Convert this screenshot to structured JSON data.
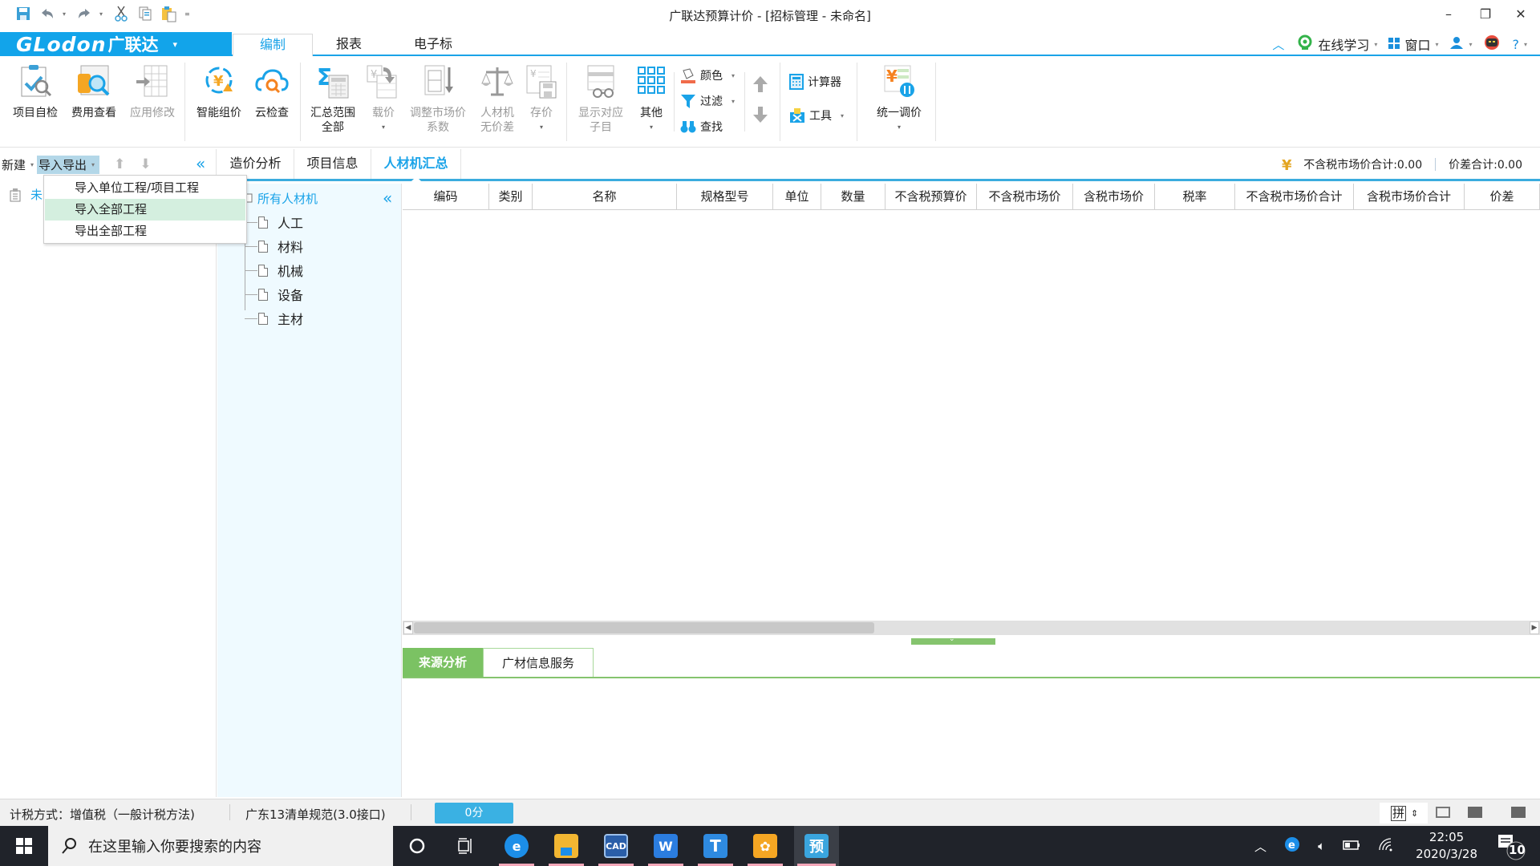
{
  "window": {
    "title": "广联达预算计价 - [招标管理 - 未命名]",
    "minimize_icon": "minimize-icon",
    "restore_icon": "restore-icon",
    "close_icon": "close-icon"
  },
  "quick_access": [
    "save-icon",
    "undo-icon",
    "redo-icon",
    "cut-icon",
    "copy-icon",
    "paste-icon",
    "customize-icon"
  ],
  "menubar": {
    "logo_brand": "GLodon",
    "logo_cn": "广联达",
    "logo_dropdown": "▾",
    "tabs": [
      {
        "label": "编制",
        "active": true
      },
      {
        "label": "报表",
        "active": false
      },
      {
        "label": "电子标",
        "active": false
      }
    ],
    "right": {
      "collapse": "^",
      "online_learning": "在线学习",
      "window": "窗口",
      "help": "?"
    }
  },
  "ribbon": {
    "buttons": [
      {
        "label": "项目自检",
        "enabled": true
      },
      {
        "label": "费用查看",
        "enabled": true
      },
      {
        "label": "应用修改",
        "enabled": false
      },
      {
        "label": "智能组价",
        "enabled": true
      },
      {
        "label": "云检查",
        "enabled": true
      },
      {
        "label": "汇总范围",
        "label2": "全部",
        "enabled": true
      },
      {
        "label": "载价",
        "enabled": false,
        "dropdown": true
      },
      {
        "label": "调整市场价",
        "label2": "系数",
        "enabled": false
      },
      {
        "label": "人材机",
        "label2": "无价差",
        "enabled": false
      },
      {
        "label": "存价",
        "enabled": false,
        "dropdown": true
      },
      {
        "label": "显示对应",
        "label2": "子目",
        "enabled": false
      },
      {
        "label": "其他",
        "enabled": true,
        "dropdown": true
      },
      {
        "label": "统一调价",
        "enabled": true,
        "dropdown": true
      }
    ],
    "small": {
      "color": "颜色",
      "filter": "过滤",
      "find": "查找",
      "calculator": "计算器",
      "tools": "工具"
    }
  },
  "left_panel": {
    "new_label": "新建",
    "import_export_label": "导入导出",
    "project_name": "未",
    "dropdown_items": [
      {
        "label": "导入单位工程/项目工程",
        "hover": false
      },
      {
        "label": "导入全部工程",
        "hover": true
      },
      {
        "label": "导出全部工程",
        "hover": false
      }
    ]
  },
  "main_tabs": [
    {
      "label": "造价分析",
      "active": false
    },
    {
      "label": "项目信息",
      "active": false
    },
    {
      "label": "人材机汇总",
      "active": true
    }
  ],
  "totals": {
    "market_total_label": "不含税市场价合计",
    "market_total_value": ":0.00",
    "diff_total_label": "价差合计",
    "diff_total_value": ":0.00"
  },
  "category_tree": {
    "root": "所有人材机",
    "items": [
      "人工",
      "材料",
      "机械",
      "设备",
      "主材"
    ]
  },
  "table": {
    "columns": [
      "编码",
      "类别",
      "名称",
      "规格型号",
      "单位",
      "数量",
      "不含税预算价",
      "不含税市场价",
      "含税市场价",
      "税率",
      "不含税市场价合计",
      "含税市场价合计",
      "价差"
    ],
    "rows": []
  },
  "bottom_tabs": [
    {
      "label": "来源分析",
      "active": true
    },
    {
      "label": "广材信息服务",
      "active": false
    }
  ],
  "statusbar": {
    "tax_method": "计税方式：增值税（一般计税方法)",
    "standard": "广东13清单规范(3.0接口)",
    "score": "0分",
    "ime": "拼"
  },
  "taskbar": {
    "search_placeholder": "在这里输入你要搜索的内容",
    "apps": [
      "cortana",
      "task-view",
      "ie",
      "file-explorer",
      "cad",
      "wps",
      "t-app",
      "glodon-app",
      "yu-app"
    ],
    "time": "22:05",
    "date": "2020/3/28",
    "notification_count": "10"
  },
  "colors": {
    "accent_blue": "#1aa3e8",
    "green": "#7bc263",
    "tree_bg": "#effaff"
  }
}
